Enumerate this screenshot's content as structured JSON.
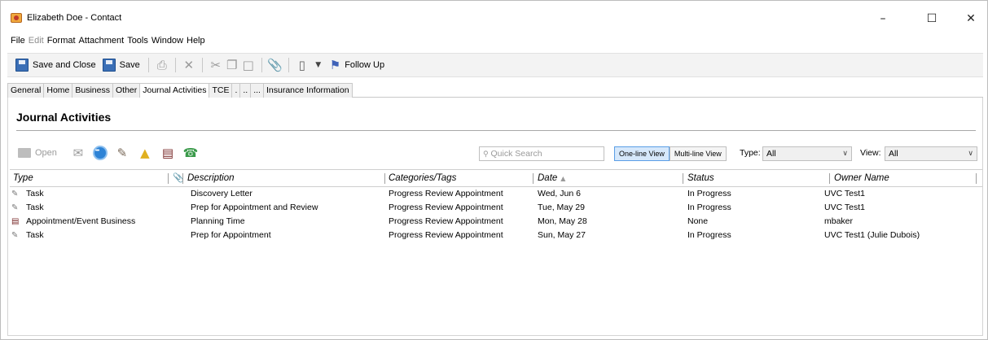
{
  "window": {
    "title": "Elizabeth Doe - Contact",
    "controls": {
      "minimize": "–",
      "maximize": "☐",
      "close": "✕"
    }
  },
  "menu": [
    "File",
    "Edit",
    "Format",
    "Attachment",
    "Tools",
    "Window",
    "Help"
  ],
  "toolbar": {
    "save_close": "Save and Close",
    "save": "Save",
    "follow_up": "Follow Up"
  },
  "tabs": [
    "General",
    "Home",
    "Business",
    "Other",
    "Journal Activities",
    "TCE",
    ".",
    "..",
    "...",
    "Insurance Information"
  ],
  "section": {
    "title": "Journal Activities"
  },
  "actions": {
    "open": "Open"
  },
  "search": {
    "placeholder": "Quick Search"
  },
  "view_modes": [
    "One-line View",
    "Multi-line View"
  ],
  "filters": {
    "type_label": "Type:",
    "type_value": "All",
    "view_label": "View:",
    "view_value": "All"
  },
  "columns": [
    "Type",
    "Description",
    "Categories/Tags",
    "Date",
    "Status",
    "Owner Name"
  ],
  "rows": [
    {
      "icon": "task-icon",
      "type": "Task",
      "description": "Discovery Letter",
      "category": "Progress Review Appointment",
      "date": "Wed, Jun 6",
      "status": "In Progress",
      "owner": "UVC Test1"
    },
    {
      "icon": "task-icon",
      "type": "Task",
      "description": "Prep for Appointment and Review",
      "category": "Progress Review Appointment",
      "date": "Tue, May 29",
      "status": "In Progress",
      "owner": "UVC Test1"
    },
    {
      "icon": "appointment-icon",
      "type": "Appointment/Event Business",
      "description": "Planning Time",
      "category": "Progress Review Appointment",
      "date": "Mon, May 28",
      "status": "None",
      "owner": "mbaker"
    },
    {
      "icon": "task-icon",
      "type": "Task",
      "description": "Prep for Appointment",
      "category": "Progress Review Appointment",
      "date": "Sun, May 27",
      "status": "In Progress",
      "owner": "UVC Test1 (Julie Dubois)"
    }
  ]
}
